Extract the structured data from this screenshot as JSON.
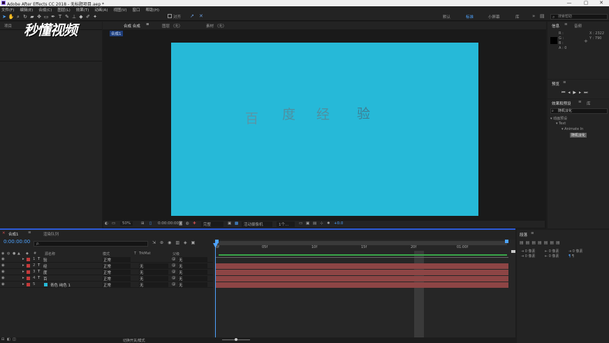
{
  "window": {
    "title": "Adobe After Effects CC 2018 - 无标题项目.aep *",
    "minimize": "—",
    "maximize": "▢",
    "close": "✕"
  },
  "menu": [
    "文件(F)",
    "编辑(E)",
    "合成(C)",
    "图层(L)",
    "效果(T)",
    "动画(A)",
    "视图(V)",
    "窗口",
    "帮助(H)"
  ],
  "toolbar": {
    "snap_label": "对齐",
    "workspaces": [
      "默认",
      "标准",
      "小屏幕",
      "库"
    ],
    "active_workspace": "标准",
    "search_placeholder": "搜索帮助"
  },
  "watermark": "秒懂视频",
  "left_panel": {
    "tab": "项目"
  },
  "viewer_tabs": {
    "comp_tab": "合成 合成",
    "layer_tab": "图层 （无）",
    "footage_tab": "素材 （无）",
    "comp_crumb": "合成1"
  },
  "comp": {
    "canvas_color": "#26b9d8",
    "chars": [
      "百",
      "度",
      "经",
      "验"
    ]
  },
  "viewer_bar": {
    "zoom": "50%",
    "timecode": "0:00:00:00",
    "resolution": "完整",
    "camera": "活动摄像机",
    "views": "1个...",
    "exposure": "+0.0"
  },
  "info_panel": {
    "tab_info": "信息",
    "tab_audio": "音频",
    "r": "R :",
    "g": "G :",
    "b": "B :",
    "a": "A : 0",
    "x": "X : 2322",
    "y": "Y : 790"
  },
  "preview_panel": {
    "tab": "预览"
  },
  "effects_panel": {
    "tab": "效果和预设",
    "tab_lib": "库",
    "search_value": "随机淡化",
    "tree": [
      "▾ 动画预设",
      "▾ Text",
      "▾ Animate In",
      "随机淡化"
    ]
  },
  "align_panel": {
    "tab": "段落"
  },
  "timeline": {
    "tab_comp": "合成1",
    "tab_render": "渲染队列",
    "timecode": "0:00:00:00",
    "search_placeholder": "ρ.",
    "columns": {
      "num": "#",
      "name": "源名称",
      "mode": "模式",
      "t": "T",
      "trkmat": "TrkMat",
      "parent": "父级"
    },
    "ruler": [
      "0f",
      "05f",
      "10f",
      "15f",
      "20f",
      "01:00f"
    ],
    "layers": [
      {
        "num": "1",
        "type": "T",
        "name": "验",
        "mode": "正常",
        "trkmat": "",
        "parent": "无"
      },
      {
        "num": "2",
        "type": "T",
        "name": "经",
        "mode": "正常",
        "trkmat": "无",
        "parent": "无"
      },
      {
        "num": "3",
        "type": "T",
        "name": "度",
        "mode": "正常",
        "trkmat": "无",
        "parent": "无"
      },
      {
        "num": "4",
        "type": "T",
        "name": "百",
        "mode": "正常",
        "trkmat": "无",
        "parent": "无"
      },
      {
        "num": "5",
        "type": "",
        "name": "青色 纯色 1",
        "mode": "正常",
        "trkmat": "无",
        "parent": "无"
      }
    ],
    "bottom_label": "切换开关/模式"
  },
  "colors": {
    "accent": "#2d5bd8",
    "layer_bar": "#8d4545",
    "green_line": "#3aa64a"
  }
}
